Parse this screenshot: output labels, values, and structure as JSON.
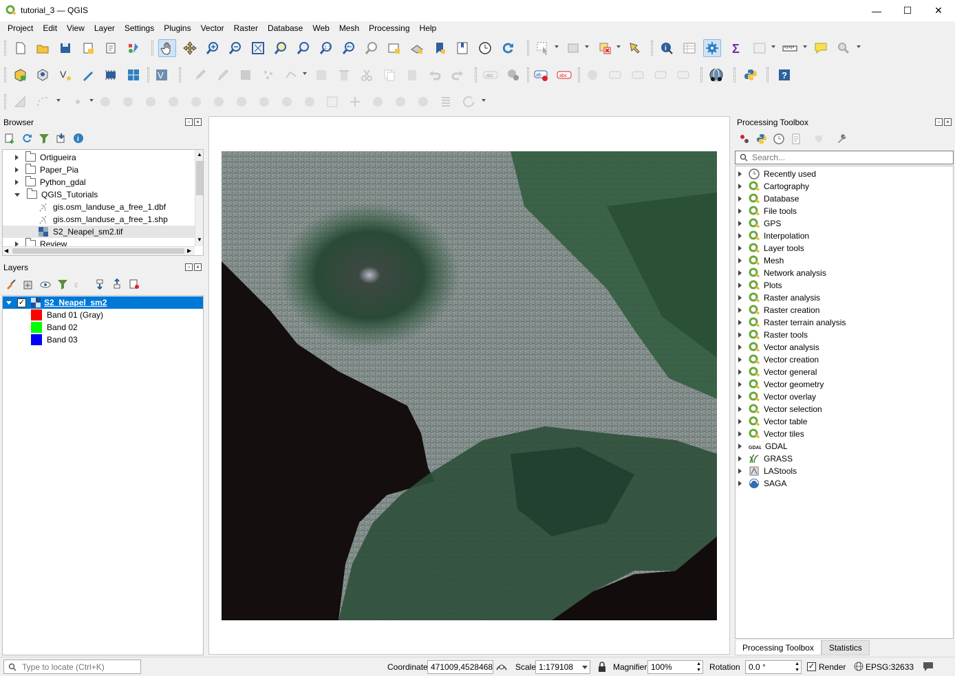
{
  "window": {
    "title": "tutorial_3 — QGIS",
    "minimize": "—",
    "maximize": "☐",
    "close": "✕"
  },
  "menu": [
    "Project",
    "Edit",
    "View",
    "Layer",
    "Settings",
    "Plugins",
    "Vector",
    "Raster",
    "Database",
    "Web",
    "Mesh",
    "Processing",
    "Help"
  ],
  "browser": {
    "title": "Browser",
    "items": [
      {
        "label": "Ortigueira",
        "type": "folder"
      },
      {
        "label": "Paper_Pia",
        "type": "folder"
      },
      {
        "label": "Python_gdal",
        "type": "folder"
      },
      {
        "label": "QGIS_Tutorials",
        "type": "folder-open"
      },
      {
        "label": "gis.osm_landuse_a_free_1.dbf",
        "type": "vector"
      },
      {
        "label": "gis.osm_landuse_a_free_1.shp",
        "type": "vector"
      },
      {
        "label": "S2_Neapel_sm2.tif",
        "type": "raster"
      },
      {
        "label": "Review",
        "type": "folder"
      }
    ]
  },
  "layers": {
    "title": "Layers",
    "layer_name": "S2_Neapel_sm2",
    "bands": [
      {
        "label": "Band 01 (Gray)",
        "color": "#ff0000"
      },
      {
        "label": "Band 02",
        "color": "#00ff00"
      },
      {
        "label": "Band 03",
        "color": "#0000ff"
      }
    ]
  },
  "toolbox": {
    "title": "Processing Toolbox",
    "search_placeholder": "Search...",
    "items": [
      {
        "label": "Recently used",
        "icon": "clock-icon"
      },
      {
        "label": "Cartography",
        "icon": "qgis-icon"
      },
      {
        "label": "Database",
        "icon": "qgis-icon"
      },
      {
        "label": "File tools",
        "icon": "qgis-icon"
      },
      {
        "label": "GPS",
        "icon": "qgis-icon"
      },
      {
        "label": "Interpolation",
        "icon": "qgis-icon"
      },
      {
        "label": "Layer tools",
        "icon": "qgis-icon"
      },
      {
        "label": "Mesh",
        "icon": "qgis-icon"
      },
      {
        "label": "Network analysis",
        "icon": "qgis-icon"
      },
      {
        "label": "Plots",
        "icon": "qgis-icon"
      },
      {
        "label": "Raster analysis",
        "icon": "qgis-icon"
      },
      {
        "label": "Raster creation",
        "icon": "qgis-icon"
      },
      {
        "label": "Raster terrain analysis",
        "icon": "qgis-icon"
      },
      {
        "label": "Raster tools",
        "icon": "qgis-icon"
      },
      {
        "label": "Vector analysis",
        "icon": "qgis-icon"
      },
      {
        "label": "Vector creation",
        "icon": "qgis-icon"
      },
      {
        "label": "Vector general",
        "icon": "qgis-icon"
      },
      {
        "label": "Vector geometry",
        "icon": "qgis-icon"
      },
      {
        "label": "Vector overlay",
        "icon": "qgis-icon"
      },
      {
        "label": "Vector selection",
        "icon": "qgis-icon"
      },
      {
        "label": "Vector table",
        "icon": "qgis-icon"
      },
      {
        "label": "Vector tiles",
        "icon": "qgis-icon"
      },
      {
        "label": "GDAL",
        "icon": "gdal-icon"
      },
      {
        "label": "GRASS",
        "icon": "grass-icon"
      },
      {
        "label": "LAStools",
        "icon": "lastools-icon"
      },
      {
        "label": "SAGA",
        "icon": "saga-icon"
      }
    ],
    "tabs": [
      "Processing Toolbox",
      "Statistics"
    ]
  },
  "status": {
    "locator_placeholder": "Type to locate (Ctrl+K)",
    "coordinate_label": "Coordinate",
    "coordinate": "471009,4528468",
    "scale_label": "Scale",
    "scale": "1:179108",
    "magnifier_label": "Magnifier",
    "magnifier": "100%",
    "rotation_label": "Rotation",
    "rotation": "0.0 °",
    "render_label": "Render",
    "epsg": "EPSG:32633"
  },
  "colors": {
    "selection": "#0078d7",
    "qgis_green": "#6aa839",
    "sea": "#100c0c"
  }
}
